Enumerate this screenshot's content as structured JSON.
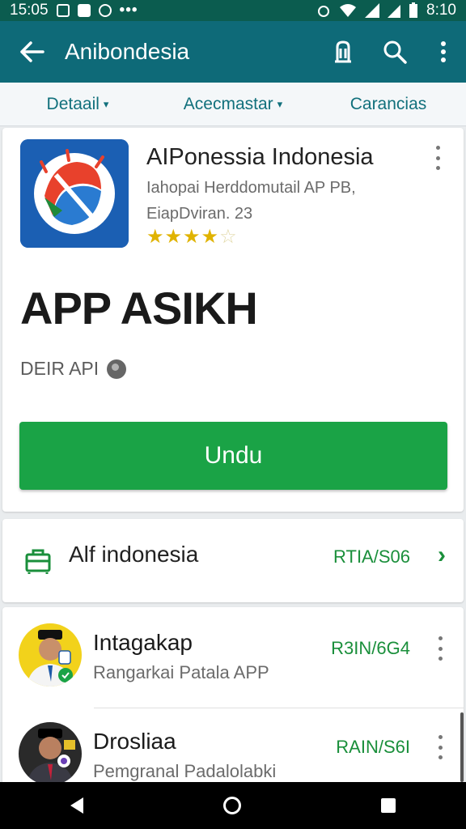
{
  "status_bar": {
    "time": "15:05",
    "right_time": "8:10"
  },
  "app_bar": {
    "title": "Anibondesia"
  },
  "tabs": [
    {
      "label": "Detaail",
      "has_dropdown": true
    },
    {
      "label": "Acecmastar",
      "has_dropdown": true
    },
    {
      "label": "Carancias",
      "has_dropdown": false
    }
  ],
  "app": {
    "name": "AIPonessia Indonesia",
    "desc_line1": "Iahopai Herddomutail AP PB,",
    "desc_line2": "EiapDviran. 23",
    "rating": 4,
    "rating_max": 5,
    "big_title": "APP ASIKH",
    "dev_line": "DEIR API",
    "install_label": "Undu"
  },
  "developer": {
    "name": "Alf indonesia",
    "code": "RTIA/S06"
  },
  "list": [
    {
      "title": "Intagakap",
      "subtitle": "Rangarkai Patala APP",
      "code": "R3IN/6G4"
    },
    {
      "title": "Drosliaa",
      "subtitle": "Pemgranal Padalolabki",
      "code": "RAIN/S6I"
    }
  ],
  "colors": {
    "appbar": "#0e6a78",
    "statusbar": "#0b5c4f",
    "accent": "#11707c",
    "install": "#1aa346",
    "code_green": "#1a8f3b"
  }
}
